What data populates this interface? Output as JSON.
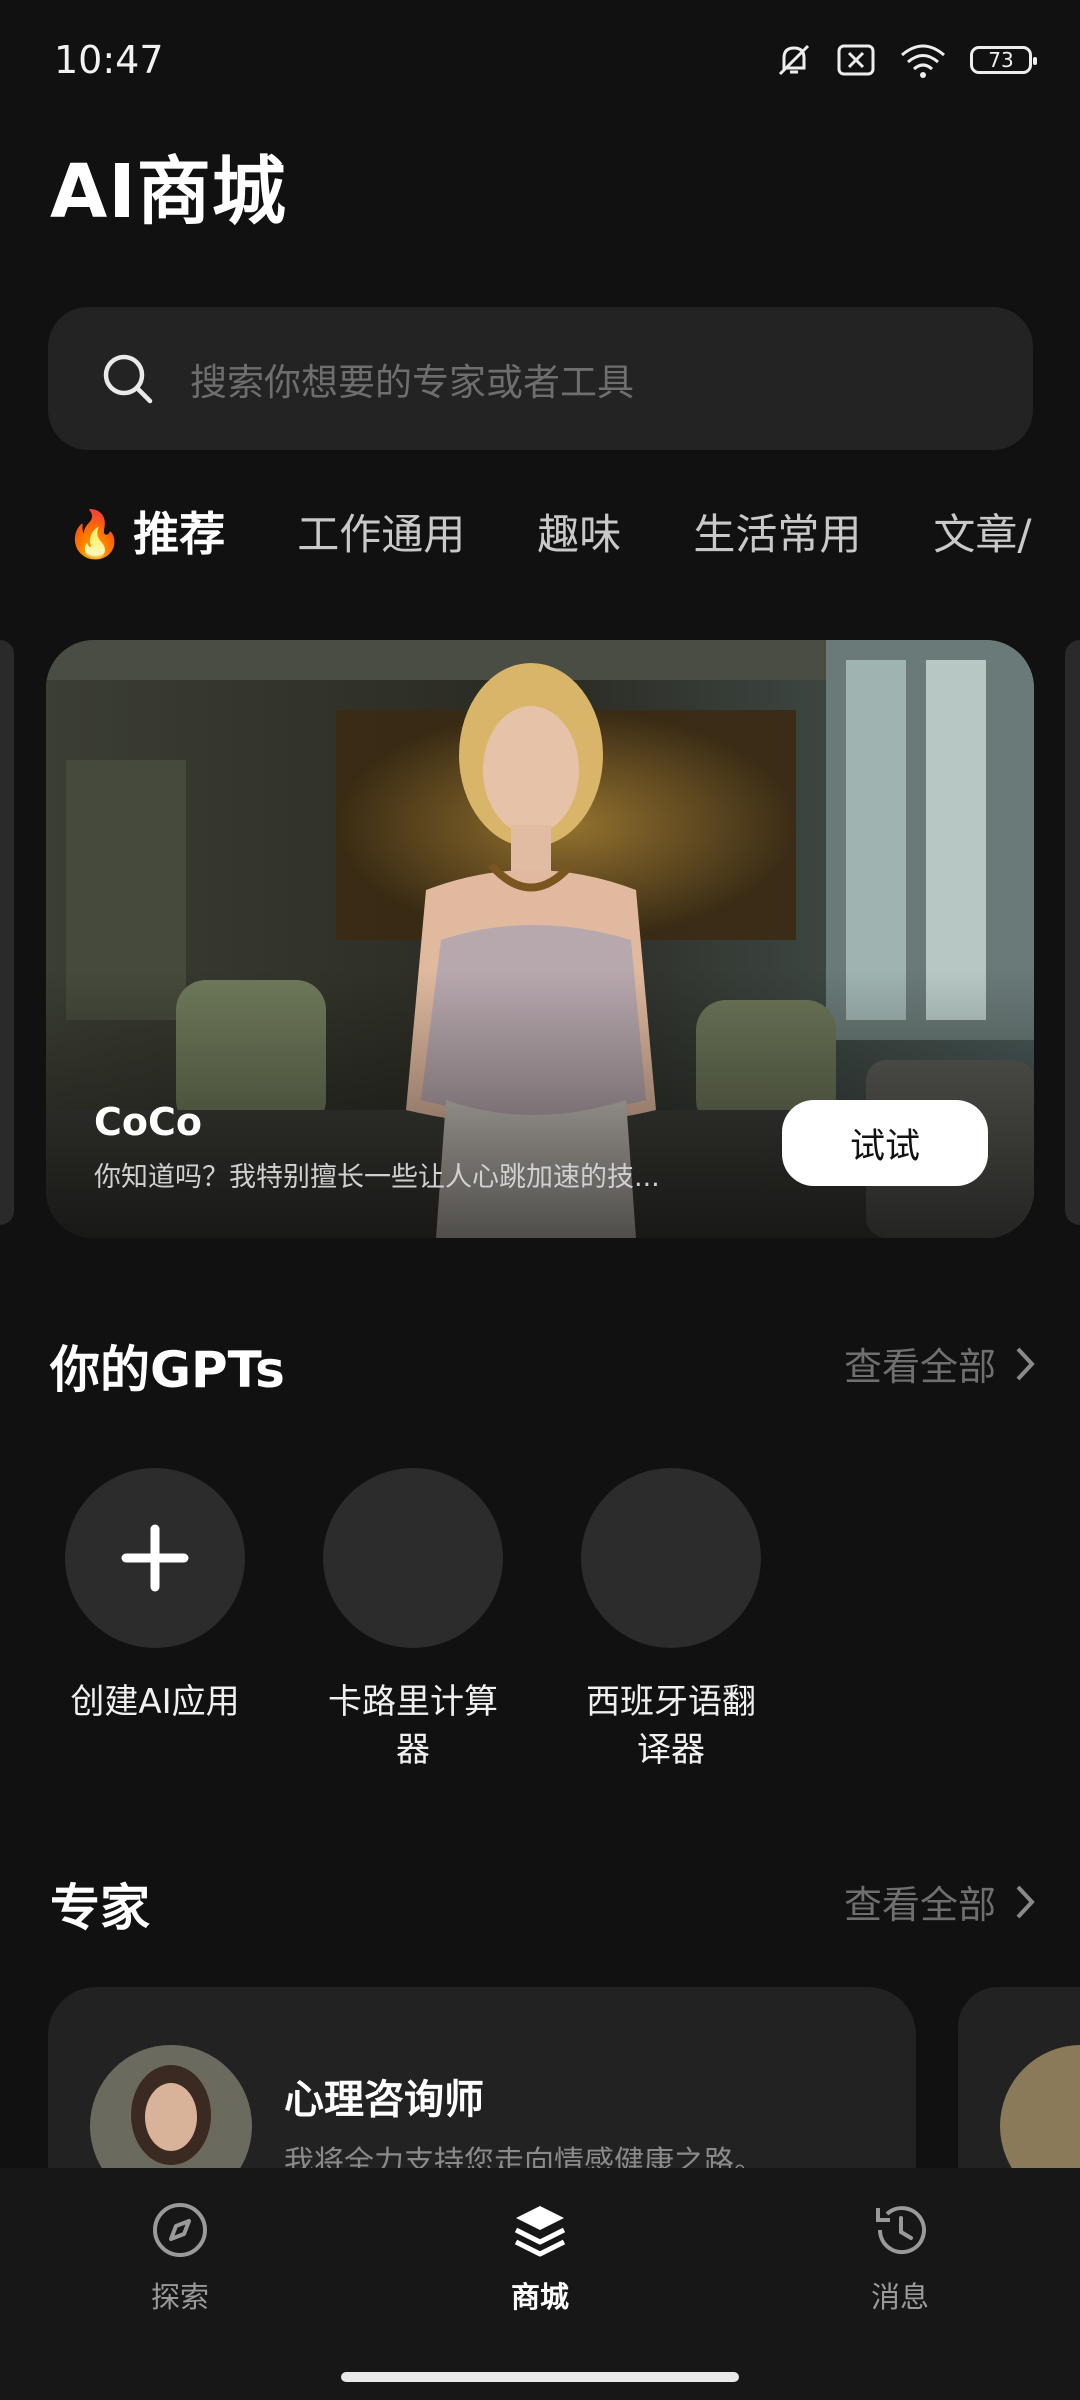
{
  "status_bar": {
    "time": "10:47",
    "battery": "73"
  },
  "page_title": "AI商城",
  "search": {
    "placeholder": "搜索你想要的专家或者工具"
  },
  "tabs": [
    {
      "label": "推荐",
      "active": true
    },
    {
      "label": "工作通用"
    },
    {
      "label": "趣味"
    },
    {
      "label": "生活常用"
    },
    {
      "label": "文章/"
    }
  ],
  "banner": {
    "name": "CoCo",
    "description": "你知道吗？我特别擅长一些让人心跳加速的技...",
    "button": "试试"
  },
  "gpts_section": {
    "title": "你的GPTs",
    "view_all": "查看全部",
    "items": [
      {
        "label_line1": "创建AI应用",
        "label_line2": ""
      },
      {
        "label_line1": "卡路里计算",
        "label_line2": "器"
      },
      {
        "label_line1": "西班牙语翻",
        "label_line2": "译器"
      }
    ]
  },
  "experts_section": {
    "title": "专家",
    "view_all": "查看全部",
    "items": [
      {
        "name": "心理咨询师",
        "description": "我将全力支持您走向情感健康之路。"
      }
    ]
  },
  "bottom_nav": [
    {
      "label": "探索",
      "icon": "compass-icon"
    },
    {
      "label": "商城",
      "icon": "layers-icon",
      "active": true
    },
    {
      "label": "消息",
      "icon": "history-icon"
    }
  ]
}
